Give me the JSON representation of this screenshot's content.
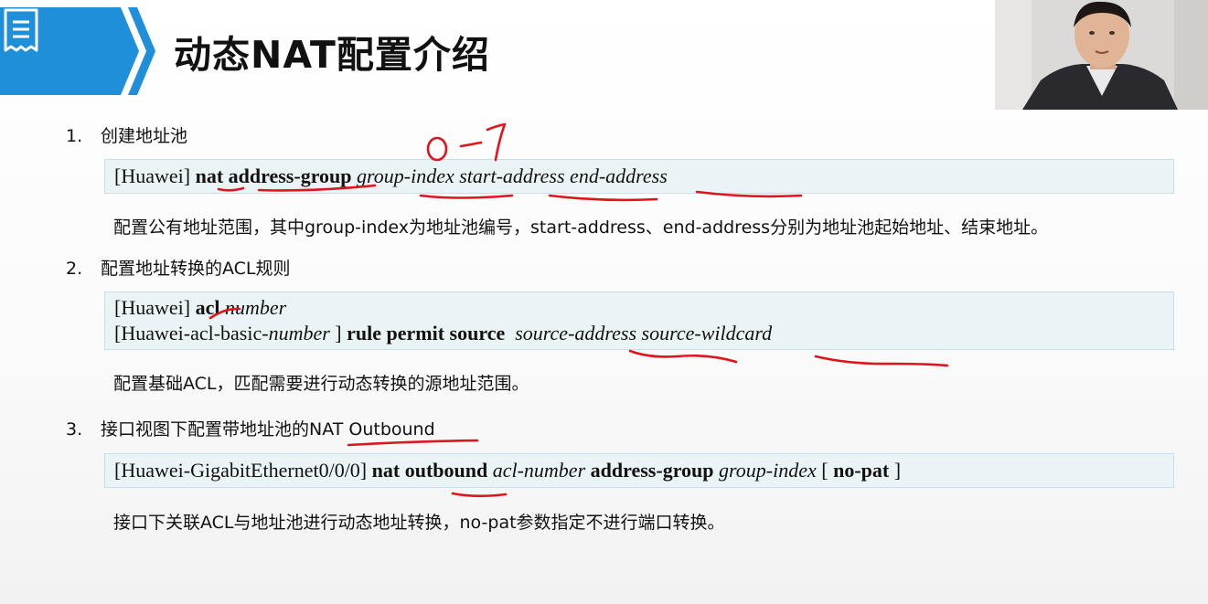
{
  "slide": {
    "title": "动态NAT配置介绍"
  },
  "sections": [
    {
      "number": "1.",
      "label": "创建地址池",
      "command_lines": [
        [
          {
            "text": "[Huawei] ",
            "style": "normal"
          },
          {
            "text": "nat address-group",
            "style": "bold"
          },
          {
            "text": " ",
            "style": "normal"
          },
          {
            "text": "group-index start-address end-address",
            "style": "italic"
          }
        ]
      ],
      "description": "配置公有地址范围，其中group-index为地址池编号，start-address、end-address分别为地址池起始地址、结束地址。"
    },
    {
      "number": "2.",
      "label": "配置地址转换的ACL规则",
      "command_lines": [
        [
          {
            "text": "[Huawei] ",
            "style": "normal"
          },
          {
            "text": "acl",
            "style": "bold"
          },
          {
            "text": " ",
            "style": "normal"
          },
          {
            "text": "number",
            "style": "italic"
          }
        ],
        [
          {
            "text": "[Huawei-acl-basic-",
            "style": "normal"
          },
          {
            "text": "number",
            "style": "italic"
          },
          {
            "text": " ] ",
            "style": "normal"
          },
          {
            "text": "rule permit source",
            "style": "bold"
          },
          {
            "text": "  ",
            "style": "normal"
          },
          {
            "text": "source-address source-wildcard",
            "style": "italic"
          }
        ]
      ],
      "description": "配置基础ACL，匹配需要进行动态转换的源地址范围。"
    },
    {
      "number": "3.",
      "label": "接口视图下配置带地址池的NAT Outbound",
      "command_lines": [
        [
          {
            "text": "[Huawei-GigabitEthernet0/0/0] ",
            "style": "normal"
          },
          {
            "text": "nat outbound",
            "style": "bold"
          },
          {
            "text": " ",
            "style": "normal"
          },
          {
            "text": "acl-number",
            "style": "italic"
          },
          {
            "text": " ",
            "style": "normal"
          },
          {
            "text": "address-group",
            "style": "bold"
          },
          {
            "text": " ",
            "style": "normal"
          },
          {
            "text": "group-index",
            "style": "italic"
          },
          {
            "text": " [ ",
            "style": "normal"
          },
          {
            "text": "no-pat",
            "style": "bold"
          },
          {
            "text": " ]",
            "style": "normal"
          }
        ]
      ],
      "description": "接口下关联ACL与地址池进行动态地址转换，no-pat参数指定不进行端口转换。"
    }
  ],
  "annotation": {
    "handwritten_text": "0-7",
    "ink_color": "#e0141b"
  },
  "colors": {
    "header_blue": "#1e8fd8",
    "box_fill": "#eaf4f7",
    "box_border": "#c5e0e8"
  },
  "icons": [
    "document-icon",
    "chevron-arrow-icon"
  ]
}
